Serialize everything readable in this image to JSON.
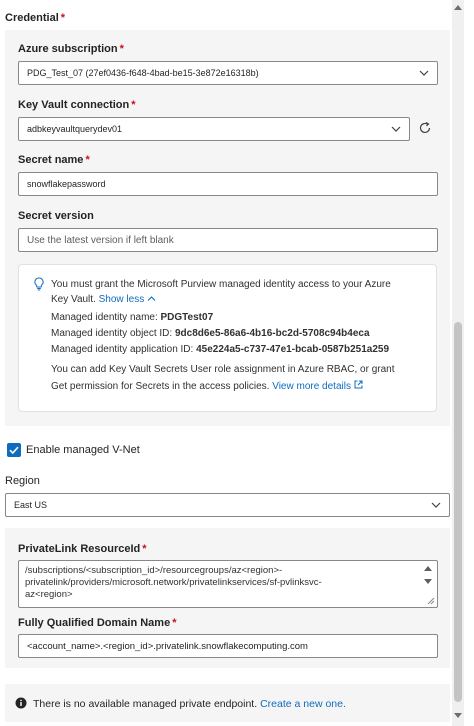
{
  "credential": {
    "label": "Credential"
  },
  "azure_subscription": {
    "label": "Azure subscription",
    "value": "PDG_Test_07 (27ef0436-f648-4bad-be15-3e872e16318b)"
  },
  "key_vault": {
    "label": "Key Vault connection",
    "value": "adbkeyvaultquerydev01"
  },
  "secret_name": {
    "label": "Secret name",
    "value": "snowflakepassword"
  },
  "secret_version": {
    "label": "Secret version",
    "placeholder": "Use the latest version if left blank"
  },
  "info": {
    "line1": "You must grant the Microsoft Purview managed identity access to your Azure",
    "line2_prefix": "Key Vault.",
    "show_less": "Show less",
    "identity_name_label": "Managed identity name:",
    "identity_name_value": "PDGTest07",
    "object_id_label": "Managed identity object ID:",
    "object_id_value": "9dc8d6e5-86a6-4b16-bc2d-5708c94b4eca",
    "app_id_label": "Managed identity application ID:",
    "app_id_value": "45e224a5-c737-47e1-bcab-0587b251a259",
    "rbac_line1": "You can add Key Vault Secrets User role assignment in Azure RBAC, or grant",
    "rbac_line2_prefix": "Get permission for Secrets in the access policies.",
    "view_more": "View more details"
  },
  "managed_vnet": {
    "label": "Enable managed V-Net",
    "checked": true
  },
  "region": {
    "label": "Region",
    "value": "East US"
  },
  "privatelink": {
    "label": "PrivateLink ResourceId",
    "value_lines": [
      "/subscriptions/<subscription_id>/resourcegroups/az<region>-",
      "privatelink/providers/microsoft.network/privatelinkservices/sf-pvlinksvc-",
      "az<region>"
    ]
  },
  "fqdn": {
    "label": "Fully Qualified Domain Name",
    "value": "<account_name>.<region_id>.privatelink.snowflakecomputing.com"
  },
  "endpoint_notice": {
    "text": "There is no available managed private endpoint.",
    "link": "Create a new one."
  },
  "colors": {
    "accent": "#0f6cbd",
    "required": "#c50f1f",
    "panel": "#f5f5f5"
  }
}
